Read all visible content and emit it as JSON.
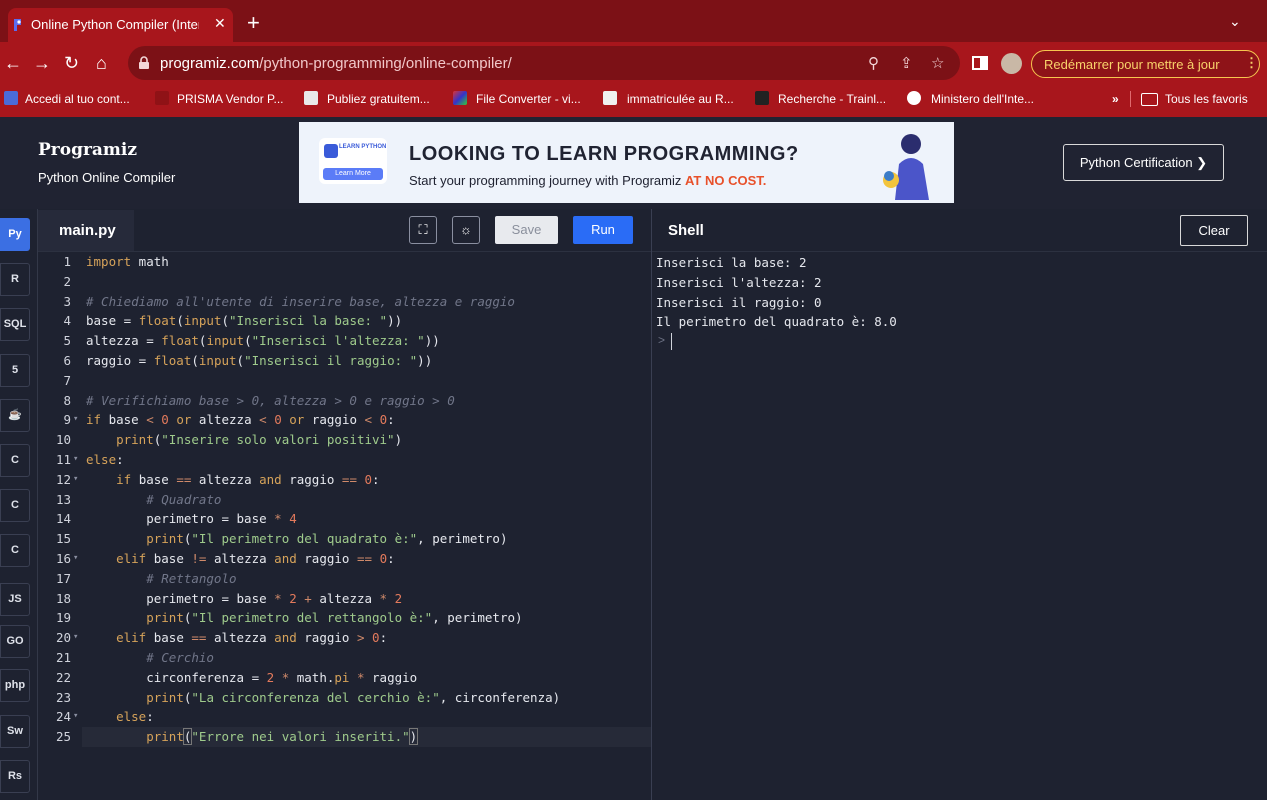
{
  "browser": {
    "tab_title": "Online Python Compiler (Interp",
    "url_domain": "programiz.com",
    "url_path": "/python-programming/online-compiler/",
    "update_button": "Redémarrer pour mettre à jour",
    "bookmarks": [
      "Accedi al tuo cont...",
      "PRISMA Vendor P...",
      "Publiez gratuitem...",
      "File Converter - vi...",
      "immatriculée au R...",
      "Recherche - Trainl...",
      "Ministero dell'Inte..."
    ],
    "bookmarks_more": "»",
    "all_bookmarks": "Tous les favoris"
  },
  "header": {
    "logo": "Programiz",
    "subtitle": "Python Online Compiler",
    "banner_badge_top": "LEARN PYTHON",
    "banner_badge_button": "Learn More",
    "banner_title": "LOOKING TO LEARN PROGRAMMING?",
    "banner_sub": "Start your programming journey with Programiz ",
    "banner_sub_highlight": "AT NO COST.",
    "cert_button": "Python Certification ❯"
  },
  "languages": [
    "Py",
    "R",
    "SQL",
    "5",
    "☕",
    "C",
    "C",
    "C",
    "JS",
    "GO",
    "php",
    "Sw",
    "Rs"
  ],
  "editor": {
    "filename": "main.py",
    "save_label": "Save",
    "run_label": "Run"
  },
  "shell": {
    "title": "Shell",
    "clear_label": "Clear",
    "output": [
      "Inserisci la base: 2",
      "Inserisci l'altezza: 2",
      "Inserisci il raggio: 0",
      "Il perimetro del quadrato è: 8.0"
    ],
    "prompt": ">"
  },
  "colors": {
    "browser_dark": "#7c1116",
    "browser_main": "#a8161c",
    "page_bg": "#1e2230",
    "run_blue": "#2a6cf6"
  }
}
